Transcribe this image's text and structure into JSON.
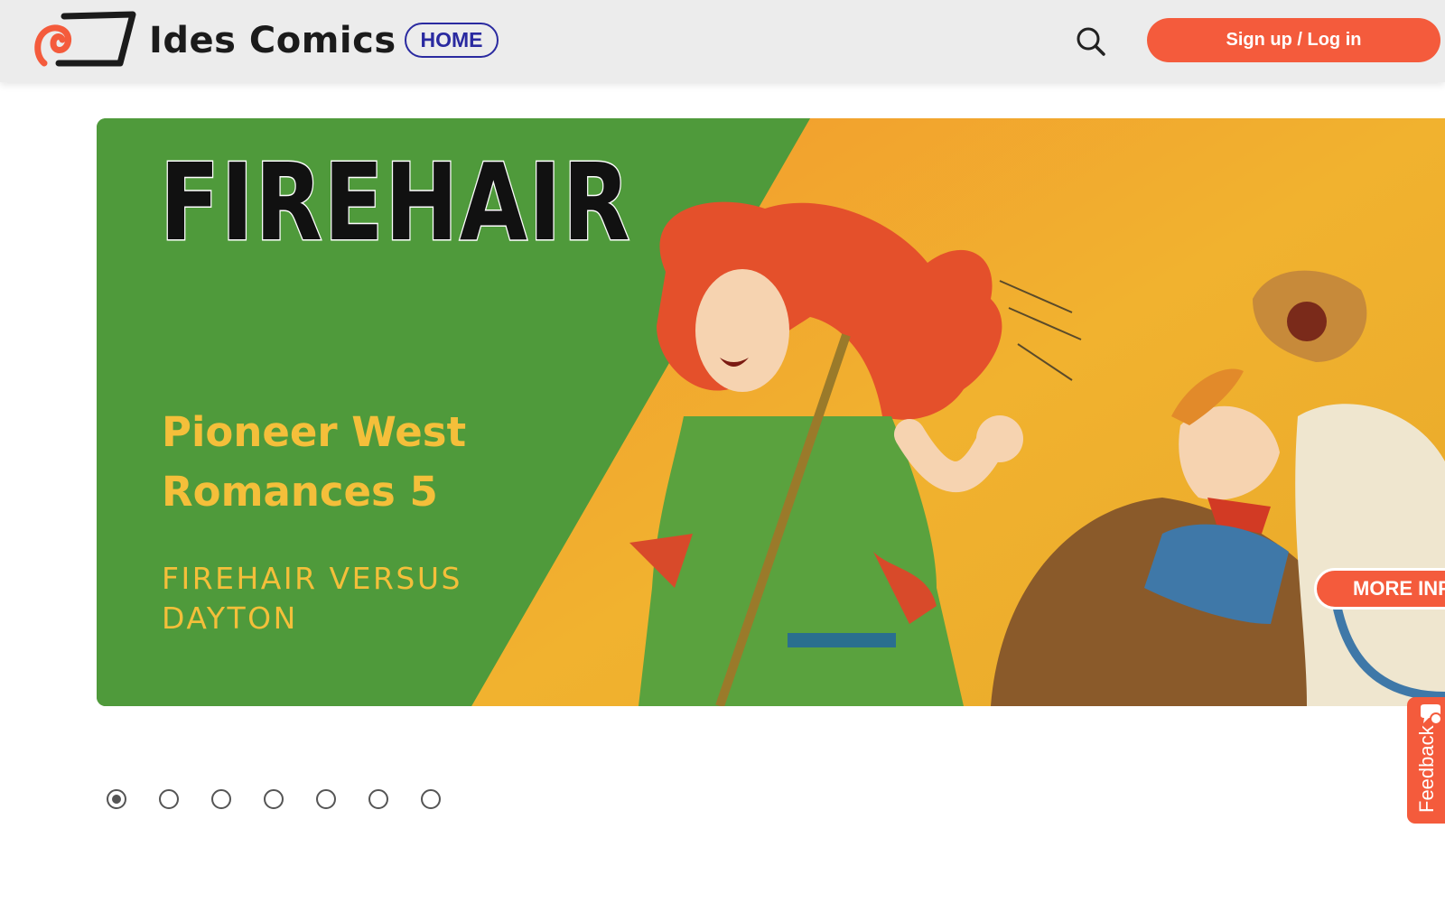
{
  "header": {
    "brand_name": "Ides Comics",
    "nav_home_label": "HOME",
    "auth_button_label": "Sign up / Log in",
    "search_icon": "search-icon",
    "logo_icon": "ides-comics-logo"
  },
  "banner": {
    "series_name": "FIREHAIR",
    "title": "Pioneer West Romances 5",
    "subtitle": "FIREHAIR VERSUS DAYTON",
    "more_info_label": "MORE INFO"
  },
  "carousel": {
    "total_slides": 7,
    "active_slide": 1
  },
  "feedback": {
    "label": "Feedback",
    "icon": "chat-bubble-icon"
  },
  "colors": {
    "accent": "#f45b3c",
    "nav_pill": "#2a2aa0",
    "banner_green": "#4f9a3b",
    "banner_yellow_text": "#f4bf3a",
    "header_bg": "#ececec"
  }
}
